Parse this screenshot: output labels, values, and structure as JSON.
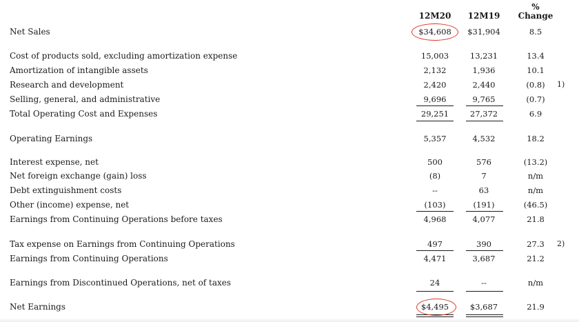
{
  "headers": {
    "col1": "12M20",
    "col2": "12M19",
    "col3_line1": "%",
    "col3_line2": "Change"
  },
  "rows": [
    {
      "label": "Net Sales",
      "v1": "$34,608",
      "v2": "$31,904",
      "v3": "8.5",
      "note": ""
    },
    {
      "label": "Cost of products sold, excluding amortization expense",
      "v1": "15,003",
      "v2": "13,231",
      "v3": "13.4",
      "note": ""
    },
    {
      "label": "Amortization of intangible assets",
      "v1": "2,132",
      "v2": "1,936",
      "v3": "10.1",
      "note": ""
    },
    {
      "label": "Research and development",
      "v1": "2,420",
      "v2": "2,440",
      "v3": "(0.8)",
      "note": "1)"
    },
    {
      "label": "Selling, general, and administrative",
      "v1": "9,696",
      "v2": "9,765",
      "v3": "(0.7)",
      "note": ""
    },
    {
      "label": "Total Operating Cost and Expenses",
      "v1": "29,251",
      "v2": "27,372",
      "v3": "6.9",
      "note": ""
    },
    {
      "label": "Operating Earnings",
      "v1": "5,357",
      "v2": "4,532",
      "v3": "18.2",
      "note": ""
    },
    {
      "label": "Interest expense, net",
      "v1": "500",
      "v2": "576",
      "v3": "(13.2)",
      "note": ""
    },
    {
      "label": "Net foreign exchange (gain) loss",
      "v1": "(8)",
      "v2": "7",
      "v3": "n/m",
      "note": ""
    },
    {
      "label": "Debt extinguishment costs",
      "v1": "--",
      "v2": "63",
      "v3": "n/m",
      "note": ""
    },
    {
      "label": "Other (income) expense, net",
      "v1": "(103)",
      "v2": "(191)",
      "v3": "(46.5)",
      "note": ""
    },
    {
      "label": "Earnings from Continuing Operations before taxes",
      "v1": "4,968",
      "v2": "4,077",
      "v3": "21.8",
      "note": ""
    },
    {
      "label": "Tax expense on Earnings from Continuing Operations",
      "v1": "497",
      "v2": "390",
      "v3": "27.3",
      "note": "2)"
    },
    {
      "label": "Earnings from Continuing Operations",
      "v1": "4,471",
      "v2": "3,687",
      "v3": "21.2",
      "note": ""
    },
    {
      "label": "Earnings from Discontinued Operations, net of taxes",
      "v1": "24",
      "v2": "--",
      "v3": "n/m",
      "note": ""
    },
    {
      "label": "Net Earnings",
      "v1": "$4,495",
      "v2": "$3,687",
      "v3": "21.9",
      "note": ""
    }
  ],
  "annotation_color": "#e0342a"
}
